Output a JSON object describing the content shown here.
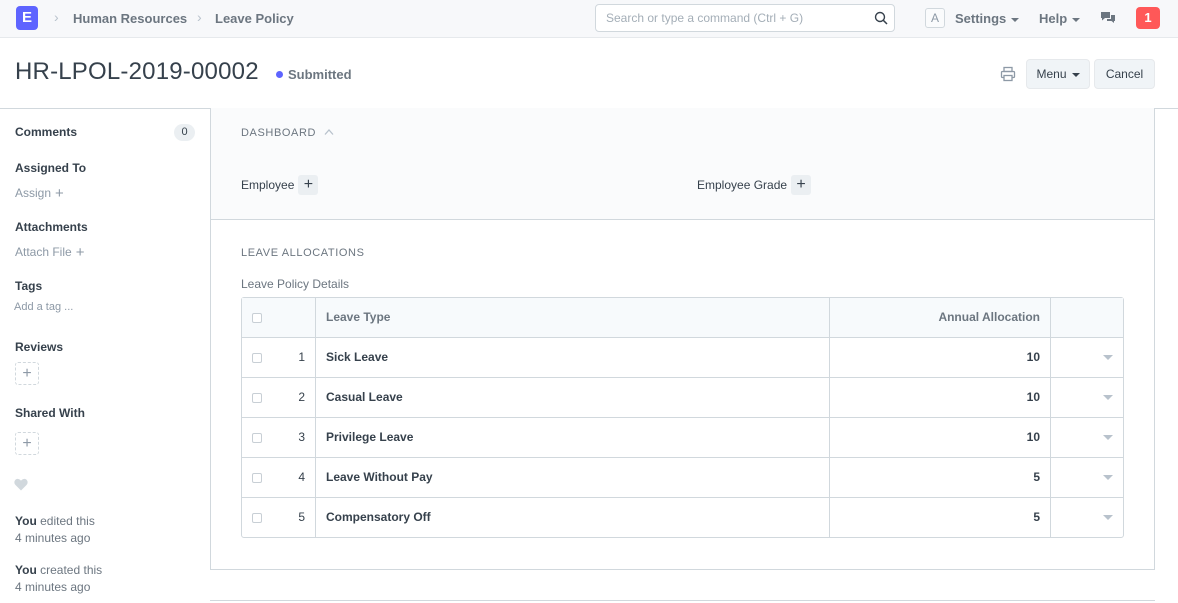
{
  "navbar": {
    "logo_letter": "E",
    "breadcrumbs": [
      "Human Resources",
      "Leave Policy"
    ],
    "search_placeholder": "Search or type a command (Ctrl + G)",
    "avatar_letter": "A",
    "settings_label": "Settings",
    "help_label": "Help",
    "notification_count": "1"
  },
  "page": {
    "title": "HR-LPOL-2019-00002",
    "status": "Submitted",
    "menu_label": "Menu",
    "cancel_label": "Cancel"
  },
  "sidebar": {
    "comments_label": "Comments",
    "comments_count": "0",
    "assigned_label": "Assigned To",
    "assign_link": "Assign",
    "attachments_label": "Attachments",
    "attach_link": "Attach File",
    "tags_label": "Tags",
    "tag_link": "Add a tag ...",
    "reviews_label": "Reviews",
    "shared_label": "Shared With",
    "timeline": [
      {
        "who": "You",
        "action": "edited this",
        "when": "4 minutes ago"
      },
      {
        "who": "You",
        "action": "created this",
        "when": "4 minutes ago"
      }
    ]
  },
  "dashboard": {
    "heading": "DASHBOARD",
    "links": [
      "Employee",
      "Employee Grade"
    ]
  },
  "allocations": {
    "heading": "LEAVE ALLOCATIONS",
    "table_label": "Leave Policy Details",
    "columns": {
      "leave_type": "Leave Type",
      "annual_allocation": "Annual Allocation"
    },
    "rows": [
      {
        "idx": "1",
        "leave_type": "Sick Leave",
        "allocation": "10"
      },
      {
        "idx": "2",
        "leave_type": "Casual Leave",
        "allocation": "10"
      },
      {
        "idx": "3",
        "leave_type": "Privilege Leave",
        "allocation": "10"
      },
      {
        "idx": "4",
        "leave_type": "Leave Without Pay",
        "allocation": "5"
      },
      {
        "idx": "5",
        "leave_type": "Compensatory Off",
        "allocation": "5"
      }
    ]
  },
  "colors": {
    "brand": "#5e64ff",
    "notification": "#ff5858",
    "status_dot": "#5e64ff"
  }
}
